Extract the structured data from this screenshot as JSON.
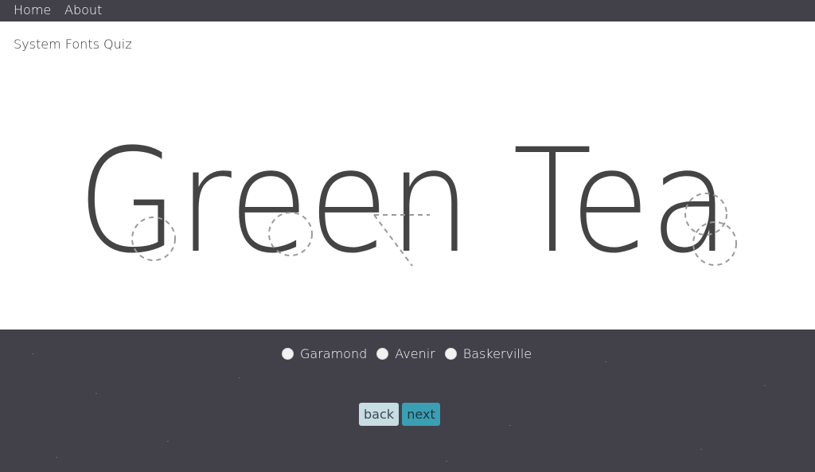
{
  "nav": {
    "home_label": "Home",
    "about_label": "About"
  },
  "quiz": {
    "title": "System Fonts Quiz",
    "specimen_text": "Green Tea"
  },
  "answers": {
    "options": [
      "Garamond",
      "Avenir",
      "Baskerville"
    ],
    "selected": null
  },
  "buttons": {
    "back_label": "back",
    "next_label": "next"
  },
  "colors": {
    "background": "#424049",
    "panel": "#ffffff",
    "specimen_text": "#444444",
    "hint_stroke": "#9a9a9a",
    "back_button": "#c6dde2",
    "next_button": "#3b9fb3"
  }
}
